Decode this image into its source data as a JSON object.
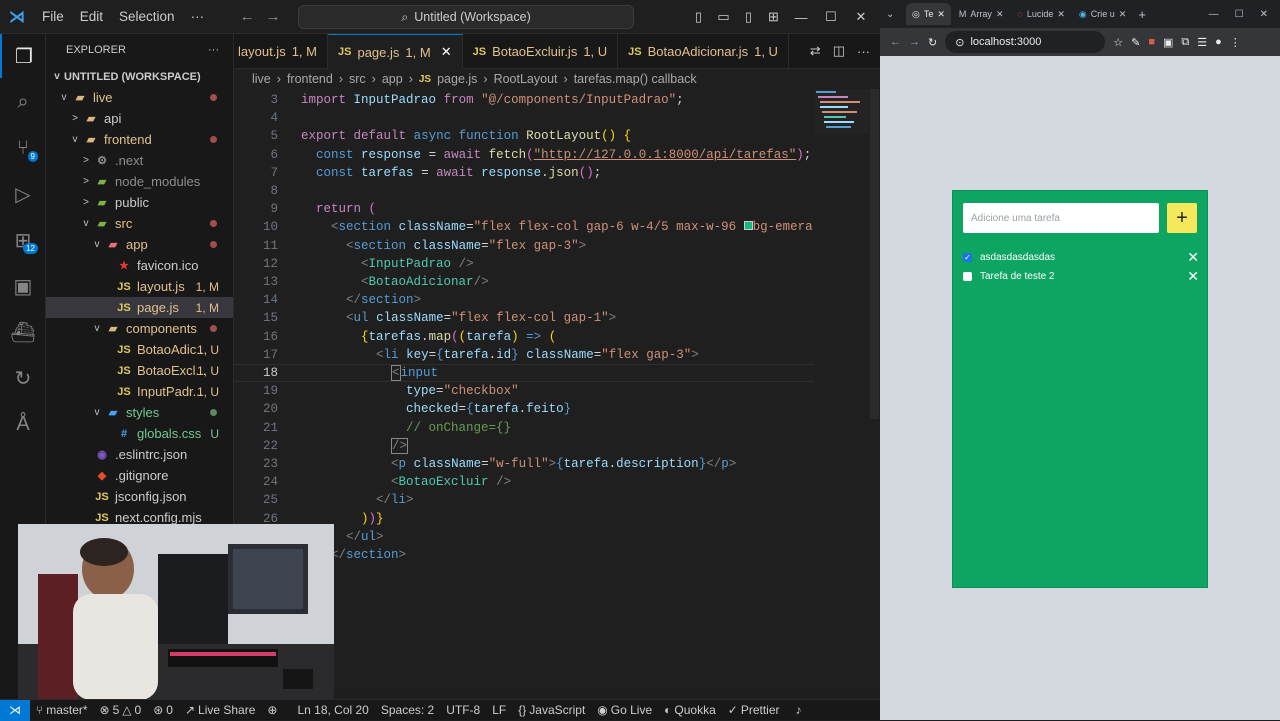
{
  "titlebar": {
    "menu": [
      "File",
      "Edit",
      "Selection"
    ],
    "more": "···",
    "search": "Untitled (Workspace)"
  },
  "activity": {
    "source_control_badge": "9",
    "extensions_badge": "12"
  },
  "explorer": {
    "title": "EXPLORER",
    "more": "···",
    "workspace": "UNTITLED (WORKSPACE)",
    "rows": [
      {
        "label": "live",
        "indent": 1,
        "chev": "v",
        "icon": "folder",
        "color": "#e2c08d",
        "mark": "dot"
      },
      {
        "label": "api",
        "indent": 2,
        "chev": ">",
        "icon": "folder",
        "color": "#cccccc",
        "mark": ""
      },
      {
        "label": "frontend",
        "indent": 2,
        "chev": "v",
        "icon": "folder",
        "color": "#e2c08d",
        "mark": "dot"
      },
      {
        "label": ".next",
        "indent": 3,
        "chev": ">",
        "icon": "gear",
        "color": "#8c8c8c",
        "mark": ""
      },
      {
        "label": "node_modules",
        "indent": 3,
        "chev": ">",
        "icon": "folder-green",
        "color": "#8c8c8c",
        "mark": ""
      },
      {
        "label": "public",
        "indent": 3,
        "chev": ">",
        "icon": "folder-green",
        "color": "#cccccc",
        "mark": ""
      },
      {
        "label": "src",
        "indent": 3,
        "chev": "v",
        "icon": "folder-green",
        "color": "#e2c08d",
        "mark": "dot"
      },
      {
        "label": "app",
        "indent": 4,
        "chev": "v",
        "icon": "folder-red",
        "color": "#e2c08d",
        "mark": "dot"
      },
      {
        "label": "favicon.ico",
        "indent": 5,
        "chev": "",
        "icon": "star",
        "color": "#cccccc",
        "mark": ""
      },
      {
        "label": "layout.js",
        "indent": 5,
        "chev": "",
        "icon": "js",
        "color": "#e2c08d",
        "mark": "1, M"
      },
      {
        "label": "page.js",
        "indent": 5,
        "chev": "",
        "icon": "js",
        "color": "#e2c08d",
        "mark": "1, M",
        "selected": true
      },
      {
        "label": "components",
        "indent": 4,
        "chev": "v",
        "icon": "folder",
        "color": "#e2c08d",
        "mark": "dot"
      },
      {
        "label": "BotaoAdic...",
        "indent": 5,
        "chev": "",
        "icon": "js",
        "color": "#e2c08d",
        "mark": "1, U"
      },
      {
        "label": "BotaoExcl...",
        "indent": 5,
        "chev": "",
        "icon": "js",
        "color": "#e2c08d",
        "mark": "1, U"
      },
      {
        "label": "InputPadr...",
        "indent": 5,
        "chev": "",
        "icon": "js",
        "color": "#e2c08d",
        "mark": "1, U"
      },
      {
        "label": "styles",
        "indent": 4,
        "chev": "v",
        "icon": "folder-blue",
        "color": "#73c991",
        "mark": "dotg"
      },
      {
        "label": "globals.css",
        "indent": 5,
        "chev": "",
        "icon": "css",
        "color": "#73c991",
        "mark": "U"
      },
      {
        "label": ".eslintrc.json",
        "indent": 3,
        "chev": "",
        "icon": "eslint",
        "color": "#cccccc",
        "mark": ""
      },
      {
        "label": ".gitignore",
        "indent": 3,
        "chev": "",
        "icon": "git",
        "color": "#cccccc",
        "mark": ""
      },
      {
        "label": "jsconfig.json",
        "indent": 3,
        "chev": "",
        "icon": "js",
        "color": "#cccccc",
        "mark": ""
      },
      {
        "label": "next.config.mjs",
        "indent": 3,
        "chev": "",
        "icon": "js",
        "color": "#cccccc",
        "mark": ""
      }
    ]
  },
  "tabs": [
    {
      "label": "layout.js",
      "mark": "1, M",
      "active": false
    },
    {
      "label": "page.js",
      "mark": "1, M",
      "active": true
    },
    {
      "label": "BotaoExcluir.js",
      "mark": "1, U",
      "active": false
    },
    {
      "label": "BotaoAdicionar.js",
      "mark": "1, U",
      "active": false
    }
  ],
  "breadcrumbs": [
    "live",
    "frontend",
    "src",
    "app",
    "page.js",
    "RootLayout",
    "tarefas.map() callback"
  ],
  "code": [
    {
      "n": "3",
      "html": "<span class='kw2'>import</span> <span class='var'>InputPadrao</span> <span class='kw2'>from</span> <span class='str'>\"@/components/InputPadrao\"</span><span class='txt'>;</span>"
    },
    {
      "n": "4",
      "html": ""
    },
    {
      "n": "5",
      "html": "<span class='kw2'>export</span> <span class='kw2'>default</span> <span class='kw'>async</span> <span class='kw'>function</span> <span class='fn'>RootLayout</span><span class='br'>()</span> <span class='br'>{</span>"
    },
    {
      "n": "6",
      "html": "  <span class='kw'>const</span> <span class='var'>response</span> <span class='txt'>=</span> <span class='kw2'>await</span> <span class='fn'>fetch</span><span class='br2'>(</span><span class='str' style='text-decoration:underline'>\"http://127.0.0.1:8000/api/tarefas\"</span><span class='br2'>)</span><span class='txt'>;</span>"
    },
    {
      "n": "7",
      "html": "  <span class='kw'>const</span> <span class='var'>tarefas</span> <span class='txt'>=</span> <span class='kw2'>await</span> <span class='var'>response</span><span class='txt'>.</span><span class='fn'>json</span><span class='br2'>()</span><span class='txt'>;</span>"
    },
    {
      "n": "8",
      "html": ""
    },
    {
      "n": "9",
      "html": "  <span class='kw2'>return</span> <span class='br2'>(</span>"
    },
    {
      "n": "10",
      "html": "    <span class='gray'>&lt;</span><span class='tag'>section</span> <span class='attr'>className</span><span class='txt'>=</span><span class='str'>\"flex flex-col gap-6 w-4/5 max-w-96 </span><span style='display:inline-block;width:9px;height:9px;background:#10b981;border:1px solid #ccc'></span><span class='str'>bg-emera</span>"
    },
    {
      "n": "11",
      "html": "      <span class='gray'>&lt;</span><span class='tag'>section</span> <span class='attr'>className</span><span class='txt'>=</span><span class='str'>\"flex gap-3\"</span><span class='gray'>&gt;</span>"
    },
    {
      "n": "12",
      "html": "        <span class='gray'>&lt;</span><span class='comp'>InputPadrao</span> <span class='gray'>/&gt;</span>"
    },
    {
      "n": "13",
      "html": "        <span class='gray'>&lt;</span><span class='comp'>BotaoAdicionar</span><span class='gray'>/&gt;</span>"
    },
    {
      "n": "14",
      "html": "      <span class='gray'>&lt;/</span><span class='tag'>section</span><span class='gray'>&gt;</span>"
    },
    {
      "n": "15",
      "html": "      <span class='gray'>&lt;</span><span class='tag'>ul</span> <span class='attr'>className</span><span class='txt'>=</span><span class='str'>\"flex flex-col gap-1\"</span><span class='gray'>&gt;</span>"
    },
    {
      "n": "16",
      "html": "        <span class='br'>{</span><span class='var'>tarefas</span><span class='txt'>.</span><span class='fn'>map</span><span class='br2'>(</span><span class='br'>(</span><span class='var'>tarefa</span><span class='br'>)</span> <span class='kw'>=&gt;</span> <span class='br'>(</span>"
    },
    {
      "n": "17",
      "html": "          <span class='gray'>&lt;</span><span class='tag'>li</span> <span class='attr'>key</span><span class='txt'>=</span><span class='kw'>{</span><span class='var'>tarefa</span><span class='txt'>.</span><span class='var'>id</span><span class='kw'>}</span> <span class='attr'>className</span><span class='txt'>=</span><span class='str'>\"flex gap-3\"</span><span class='gray'>&gt;</span>"
    },
    {
      "n": "18",
      "html": "            <span class='gray' style='border:1px solid #888'>&lt;</span><span class='tag'>input</span>",
      "cur": true
    },
    {
      "n": "19",
      "html": "              <span class='attr'>type</span><span class='txt'>=</span><span class='str'>\"checkbox\"</span>"
    },
    {
      "n": "20",
      "html": "              <span class='attr'>checked</span><span class='txt'>=</span><span class='kw'>{</span><span class='var'>tarefa</span><span class='txt'>.</span><span class='var'>feito</span><span class='kw'>}</span>"
    },
    {
      "n": "21",
      "html": "              <span class='cmt'>// onChange={}</span>"
    },
    {
      "n": "22",
      "html": "            <span class='gray' style='border:1px solid #888'>/&gt;</span>"
    },
    {
      "n": "23",
      "html": "            <span class='gray'>&lt;</span><span class='tag'>p</span> <span class='attr'>className</span><span class='txt'>=</span><span class='str'>\"w-full\"</span><span class='gray'>&gt;</span><span class='kw'>{</span><span class='var'>tarefa</span><span class='txt'>.</span><span class='var'>description</span><span class='kw'>}</span><span class='gray'>&lt;/</span><span class='tag'>p</span><span class='gray'>&gt;</span>"
    },
    {
      "n": "24",
      "html": "            <span class='gray'>&lt;</span><span class='comp'>BotaoExcluir</span> <span class='gray'>/&gt;</span>"
    },
    {
      "n": "25",
      "html": "          <span class='gray'>&lt;/</span><span class='tag'>li</span><span class='gray'>&gt;</span>"
    },
    {
      "n": "26",
      "html": "        <span class='br'>)</span><span class='br2'>)</span><span class='br'>}</span>"
    },
    {
      "n": "",
      "html": "      <span class='gray'>&lt;/</span><span class='tag'>ul</span><span class='gray'>&gt;</span>"
    },
    {
      "n": "",
      "html": "    <span class='gray'>&lt;/</span><span class='tag'>section</span><span class='gray'>&gt;</span>"
    }
  ],
  "status": {
    "branch": "master*",
    "errors": "5",
    "warnings": "0",
    "ports": "0",
    "liveshare": "Live Share",
    "position": "Ln 18, Col 20",
    "spaces": "Spaces: 2",
    "encoding": "UTF-8",
    "eol": "LF",
    "language": "JavaScript",
    "golive": "Go Live",
    "quokka": "Quokka",
    "prettier": "Prettier"
  },
  "browser": {
    "tabs": [
      "Te",
      "Array",
      "Lucide",
      "Crie u"
    ],
    "url": "localhost:3000",
    "input_placeholder": "Adicione uma tarefa",
    "add_label": "+",
    "tasks": [
      {
        "label": "asdasdasdasdas",
        "done": true
      },
      {
        "label": "Tarefa de teste 2",
        "done": false
      }
    ]
  }
}
